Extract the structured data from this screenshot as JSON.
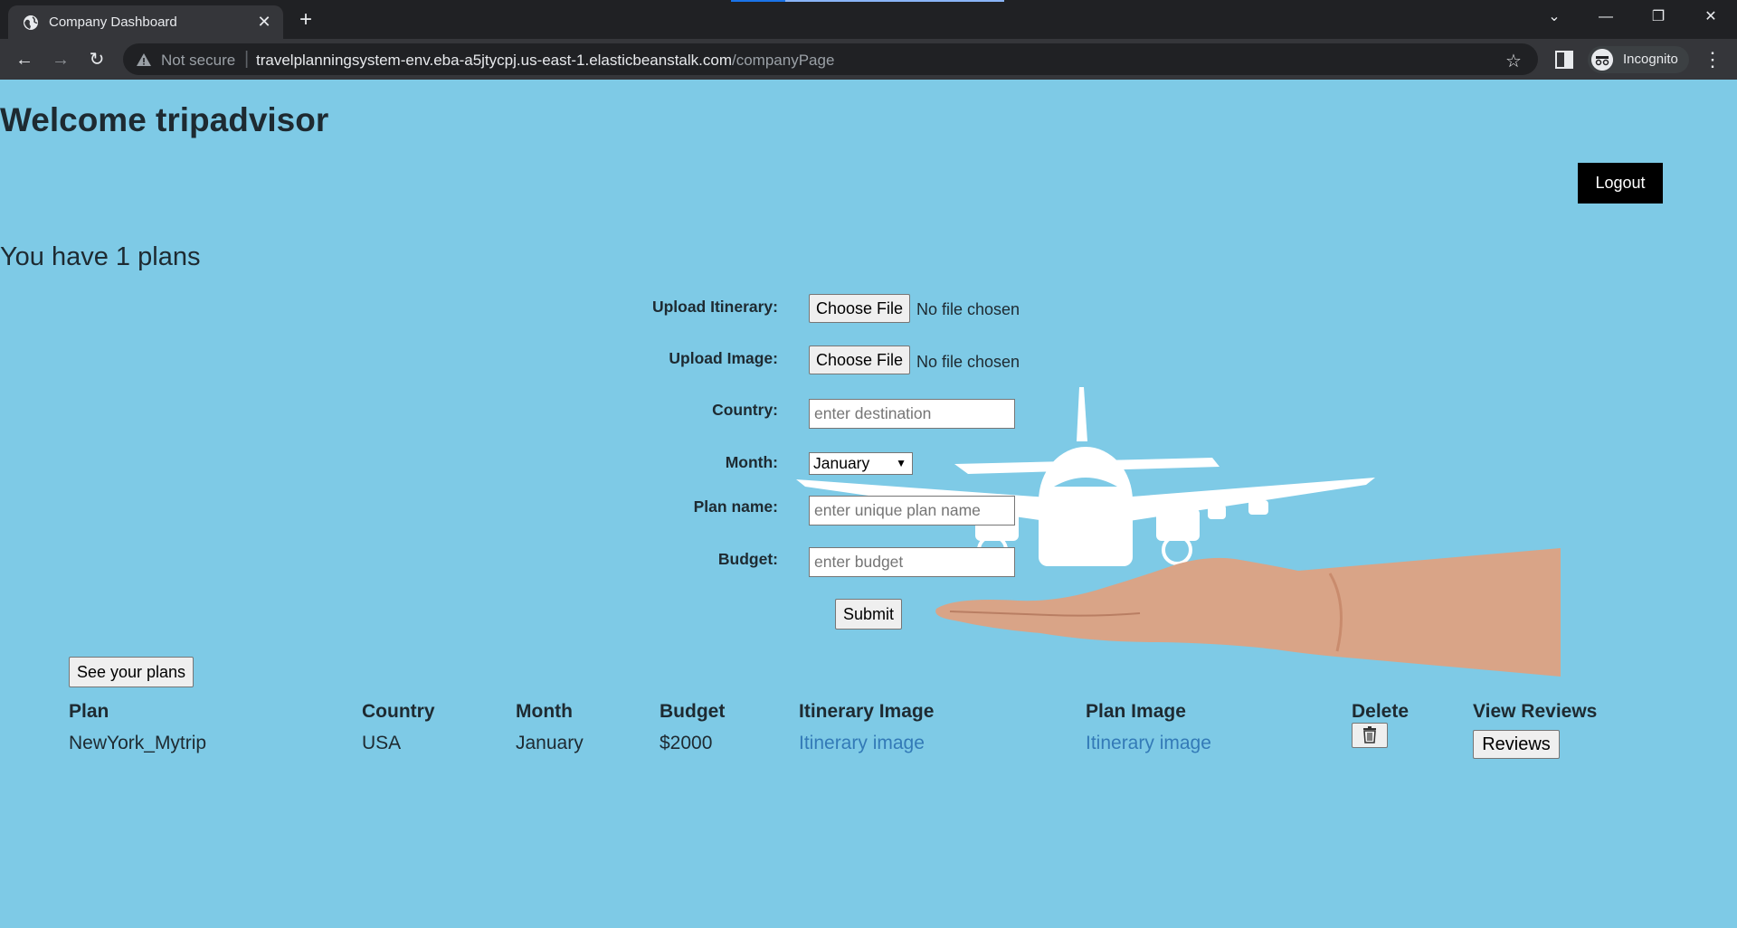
{
  "browser": {
    "tab_title": "Company Dashboard",
    "security_label": "Not secure",
    "url_host": "travelplanningsystem-env.eba-a5jtycpj.us-east-1.elasticbeanstalk.com",
    "url_path": "/companyPage",
    "profile_label": "Incognito"
  },
  "header": {
    "welcome": "Welcome tripadvisor",
    "logout_label": "Logout"
  },
  "summary": {
    "plans_count_text": "You have 1 plans"
  },
  "form": {
    "itinerary_label": "Upload Itinerary:",
    "image_label": "Upload Image:",
    "choose_file_label": "Choose File",
    "no_file_text": "No file chosen",
    "country_label": "Country:",
    "country_placeholder": "enter destination",
    "month_label": "Month:",
    "month_selected": "January",
    "plan_name_label": "Plan name:",
    "plan_name_placeholder": "enter unique plan name",
    "budget_label": "Budget:",
    "budget_placeholder": "enter budget",
    "submit_label": "Submit"
  },
  "plans": {
    "see_plans_label": "See your plans",
    "columns": [
      "Plan",
      "Country",
      "Month",
      "Budget",
      "Itinerary Image",
      "Plan Image",
      "Delete",
      "View Reviews"
    ],
    "rows": [
      {
        "plan": "NewYork_Mytrip",
        "country": "USA",
        "month": "January",
        "budget": "$2000",
        "itinerary_link": "Itinerary image",
        "plan_image_link": "Itinerary image",
        "reviews_label": "Reviews"
      }
    ]
  },
  "colors": {
    "page_background": "#7ecae6",
    "link": "#337ab7",
    "logout_background": "#000000"
  }
}
